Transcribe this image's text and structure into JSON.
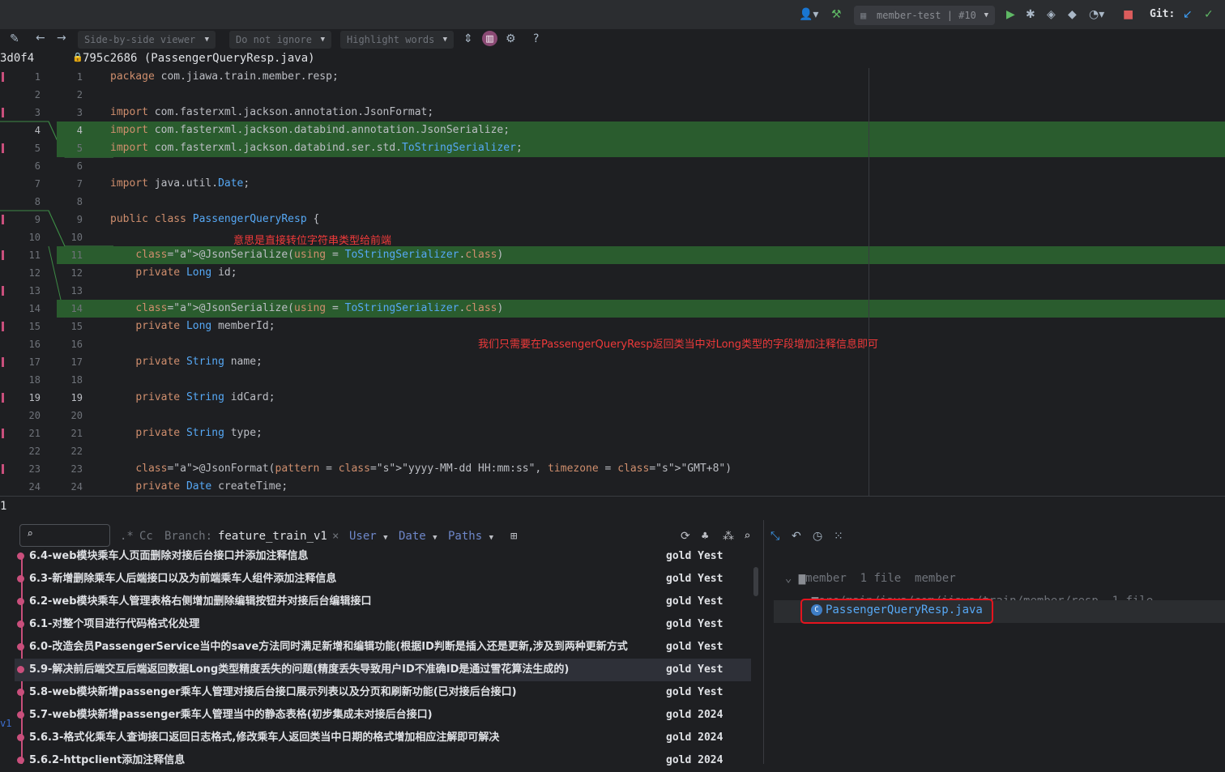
{
  "toolbar": {
    "run_config": "member-test | #10",
    "git_label": "Git:"
  },
  "diff_toolbar": {
    "viewer": "Side-by-side viewer",
    "ignore": "Do not ignore",
    "highlight": "Highlight words",
    "help": "?"
  },
  "header": {
    "left_hash": "3d0f4",
    "right_title": "795c2686 (PassengerQueryResp.java)"
  },
  "code_lines": [
    {
      "n1": "1",
      "n2": "1",
      "text": "package com.jiawa.train.member.resp;"
    },
    {
      "n1": "2",
      "n2": "2",
      "text": ""
    },
    {
      "n1": "3",
      "n2": "3",
      "text": "import com.fasterxml.jackson.annotation.JsonFormat;"
    },
    {
      "n1": "4",
      "n2": "4",
      "text": "import com.fasterxml.jackson.databind.annotation.JsonSerialize;"
    },
    {
      "n1": "5",
      "n2": "5",
      "text": "import com.fasterxml.jackson.databind.ser.std.ToStringSerializer;"
    },
    {
      "n1": "6",
      "n2": "6",
      "text": ""
    },
    {
      "n1": "7",
      "n2": "7",
      "text": "import java.util.Date;"
    },
    {
      "n1": "8",
      "n2": "8",
      "text": ""
    },
    {
      "n1": "9",
      "n2": "9",
      "text": "public class PassengerQueryResp {"
    },
    {
      "n1": "10",
      "n2": "10",
      "text": ""
    },
    {
      "n1": "11",
      "n2": "11",
      "text": "    @JsonSerialize(using = ToStringSerializer.class)"
    },
    {
      "n1": "12",
      "n2": "12",
      "text": "    private Long id;"
    },
    {
      "n1": "13",
      "n2": "13",
      "text": ""
    },
    {
      "n1": "14",
      "n2": "14",
      "text": "    @JsonSerialize(using = ToStringSerializer.class)"
    },
    {
      "n1": "15",
      "n2": "15",
      "text": "    private Long memberId;"
    },
    {
      "n1": "16",
      "n2": "16",
      "text": ""
    },
    {
      "n1": "17",
      "n2": "17",
      "text": "    private String name;"
    },
    {
      "n1": "18",
      "n2": "18",
      "text": ""
    },
    {
      "n1": "19",
      "n2": "19",
      "text": "    private String idCard;"
    },
    {
      "n1": "20",
      "n2": "20",
      "text": ""
    },
    {
      "n1": "21",
      "n2": "21",
      "text": "    private String type;"
    },
    {
      "n1": "22",
      "n2": "22",
      "text": ""
    },
    {
      "n1": "23",
      "n2": "23",
      "text": "    @JsonFormat(pattern = \"yyyy-MM-dd HH:mm:ss\", timezone = \"GMT+8\")"
    },
    {
      "n1": "24",
      "n2": "24",
      "text": "    private Date createTime;"
    }
  ],
  "annotations": {
    "note1": "意思是直接转位字符串类型给前端",
    "note2": "我们只需要在PassengerQueryResp返回类当中对Long类型的字段增加注释信息即可"
  },
  "split_label": "1",
  "vcs": {
    "regex_label": ".*",
    "case_label": "Cc",
    "branch_label": "Branch:",
    "branch_value": "feature_train_v1",
    "branch_close": "×",
    "user_label": "User",
    "date_label": "Date",
    "paths_label": "Paths",
    "side_label": "v1",
    "commits": [
      {
        "msg": "6.4-web模块乘车人页面删除对接后台接口并添加注释信息",
        "author": "gold Yest"
      },
      {
        "msg": "6.3-新增删除乘车人后端接口以及为前端乘车人组件添加注释信息",
        "author": "gold Yest"
      },
      {
        "msg": "6.2-web模块乘车人管理表格右侧增加删除编辑按钮并对接后台编辑接口",
        "author": "gold Yest"
      },
      {
        "msg": "6.1-对整个项目进行代码格式化处理",
        "author": "gold Yest"
      },
      {
        "msg": "6.0-改造会员PassengerService当中的save方法同时满足新增和编辑功能(根据ID判断是插入还是更新,涉及到两种更新方式",
        "author": "gold Yest"
      },
      {
        "msg": "5.9-解决前后端交互后端返回数据Long类型精度丢失的问题(精度丢失导致用户ID不准确ID是通过雪花算法生成的)",
        "author": "gold Yest"
      },
      {
        "msg": "5.8-web模块新增passenger乘车人管理对接后台接口展示列表以及分页和刷新功能(已对接后台接口)",
        "author": "gold Yest"
      },
      {
        "msg": "5.7-web模块新增passenger乘车人管理当中的静态表格(初步集成未对接后台接口)",
        "author": "gold 2024"
      },
      {
        "msg": "5.6.3-格式化乘车人查询接口返回日志格式,修改乘车人返回类当中日期的格式增加相应注解即可解决",
        "author": "gold 2024"
      },
      {
        "msg": "5.6.2-httpclient添加注释信息",
        "author": "gold 2024"
      }
    ]
  },
  "files": {
    "root": "member",
    "root_count": "1 file",
    "root_module": "member",
    "dir": "src/main/java/com/jiawa/train/member/resp",
    "dir_count": "1 file",
    "file": "PassengerQueryResp.java"
  },
  "colors": {
    "added_bg": "#2a5c2e",
    "annotation_red": "#ef3a3a",
    "selection_box": "#e5141e",
    "graph_pink": "#c94f7c"
  }
}
